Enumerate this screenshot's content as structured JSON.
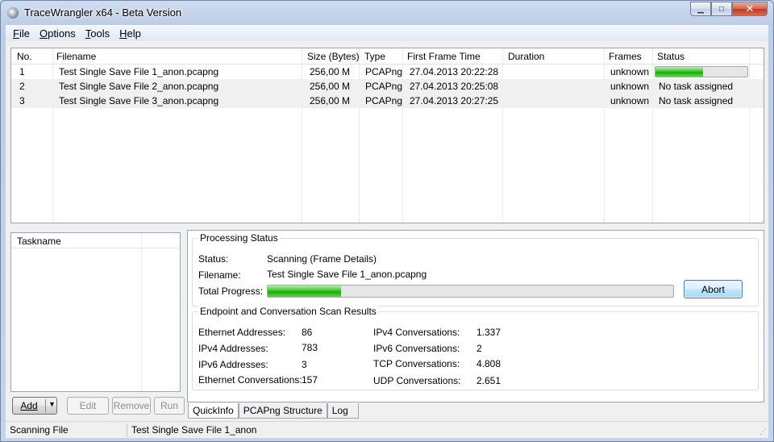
{
  "window": {
    "title": "TraceWrangler x64 - Beta Version"
  },
  "menu": [
    {
      "label": "File",
      "accel": "F",
      "rest": "ile"
    },
    {
      "label": "Options",
      "accel": "O",
      "rest": "ptions"
    },
    {
      "label": "Tools",
      "accel": "T",
      "rest": "ools"
    },
    {
      "label": "Help",
      "accel": "H",
      "rest": "elp"
    }
  ],
  "filelist": {
    "columns": [
      "No.",
      "Filename",
      "Size (Bytes)",
      "Type",
      "First Frame Time",
      "Duration",
      "Frames",
      "Status"
    ],
    "rows": [
      {
        "no": "1",
        "filename": "Test Single Save File 1_anon.pcapng",
        "size": "256,00 M",
        "type": "PCAPng",
        "first_frame_time": "27.04.2013 20:22:28",
        "duration": "",
        "frames": "unknown",
        "status": "",
        "progress": 0.52
      },
      {
        "no": "2",
        "filename": "Test Single Save File 2_anon.pcapng",
        "size": "256,00 M",
        "type": "PCAPng",
        "first_frame_time": "27.04.2013 20:25:08",
        "duration": "",
        "frames": "unknown",
        "status": "No task assigned"
      },
      {
        "no": "3",
        "filename": "Test Single Save File 3_anon.pcapng",
        "size": "256,00 M",
        "type": "PCAPng",
        "first_frame_time": "27.04.2013 20:27:25",
        "duration": "",
        "frames": "unknown",
        "status": "No task assigned"
      }
    ]
  },
  "tasks": {
    "header": "Taskname"
  },
  "buttons": {
    "add": "Add",
    "edit": "Edit",
    "remove": "Remove",
    "run": "Run"
  },
  "processing": {
    "title": "Processing Status",
    "status_label": "Status:",
    "status_value": "Scanning (Frame Details)",
    "filename_label": "Filename:",
    "filename_value": "Test Single Save File 1_anon.pcapng",
    "progress_label": "Total Progress:",
    "progress": 0.18,
    "abort": "Abort"
  },
  "results": {
    "title": "Endpoint and Conversation Scan Results",
    "left": [
      {
        "label": "Ethernet Addresses:",
        "value": "86"
      },
      {
        "label": "IPv4 Addresses:",
        "value": "783"
      },
      {
        "label": "IPv6 Addresses:",
        "value": "3"
      },
      {
        "label": "Ethernet Conversations:",
        "value": "157"
      }
    ],
    "right": [
      {
        "label": "IPv4 Conversations:",
        "value": "1.337"
      },
      {
        "label": "IPv6 Conversations:",
        "value": "2"
      },
      {
        "label": "TCP Conversations:",
        "value": "4.808"
      },
      {
        "label": "UDP Conversations:",
        "value": "2.651"
      }
    ]
  },
  "tabs": [
    "QuickInfo",
    "PCAPng Structure",
    "Log"
  ],
  "statusbar": {
    "left": "Scanning File",
    "right": "Test Single Save File 1_anon"
  },
  "colors": {
    "progress_green": "#10b000",
    "accent": "#3c7fb1"
  }
}
